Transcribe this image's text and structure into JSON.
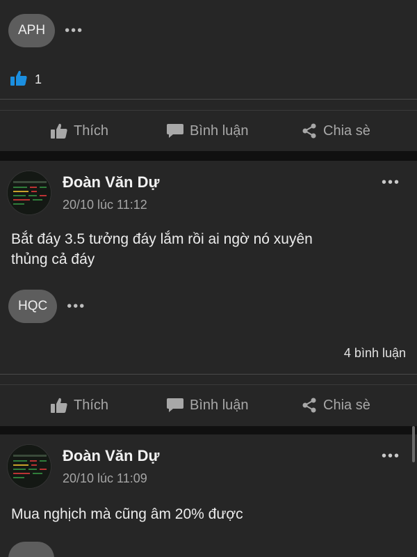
{
  "top_post": {
    "tag_chip": "APH",
    "like_count": "1"
  },
  "actions": {
    "like": "Thích",
    "comment": "Bình luận",
    "share": "Chia sè"
  },
  "post1": {
    "author": "Đoàn Văn Dự",
    "time": "20/10 lúc 11:12",
    "text_line1": "Bắt đáy 3.5 tưởng đáy lắm rồi ai ngờ nó xuyên",
    "text_line2": "thủng cả đáy",
    "tag_chip": "HQC",
    "comments": "4 bình luận"
  },
  "post2": {
    "author": "Đoàn Văn Dự",
    "time": "20/10 lúc 11:09",
    "text_line1": "Mua nghịch mà cũng âm 20% được"
  },
  "icons": {
    "like": "thumbs-up-icon",
    "comment": "speech-bubble-icon",
    "share": "share-icon",
    "menu": "more-dots-icon"
  },
  "colors": {
    "background": "#101010",
    "card": "#262626",
    "chip": "#5d5d5d",
    "like_blue": "#1b8fe0"
  }
}
